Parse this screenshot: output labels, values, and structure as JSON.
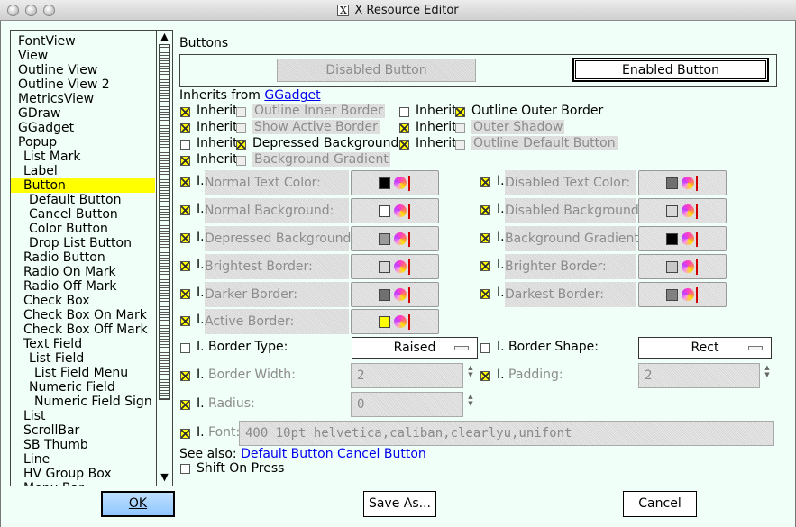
{
  "window": {
    "title": "X Resource Editor",
    "x_glyph": "X"
  },
  "list": {
    "items": [
      {
        "label": "FontView",
        "indent": 0
      },
      {
        "label": "View",
        "indent": 0
      },
      {
        "label": "Outline View",
        "indent": 0
      },
      {
        "label": "Outline View 2",
        "indent": 0
      },
      {
        "label": "MetricsView",
        "indent": 0
      },
      {
        "label": "GDraw",
        "indent": 0
      },
      {
        "label": "GGadget",
        "indent": 0
      },
      {
        "label": "Popup",
        "indent": 0
      },
      {
        "label": "List Mark",
        "indent": 1
      },
      {
        "label": "Label",
        "indent": 1
      },
      {
        "label": "Button",
        "indent": 1,
        "selected": true
      },
      {
        "label": "Default Button",
        "indent": 2
      },
      {
        "label": "Cancel Button",
        "indent": 2
      },
      {
        "label": "Color Button",
        "indent": 2
      },
      {
        "label": "Drop List Button",
        "indent": 2
      },
      {
        "label": "Radio Button",
        "indent": 1
      },
      {
        "label": "Radio On Mark",
        "indent": 1
      },
      {
        "label": "Radio Off Mark",
        "indent": 1
      },
      {
        "label": "Check Box",
        "indent": 1
      },
      {
        "label": "Check Box On Mark",
        "indent": 1
      },
      {
        "label": "Check Box Off Mark",
        "indent": 1
      },
      {
        "label": "Text Field",
        "indent": 1
      },
      {
        "label": "List Field",
        "indent": 2
      },
      {
        "label": "List Field Menu",
        "indent": 3
      },
      {
        "label": "Numeric Field",
        "indent": 2
      },
      {
        "label": "Numeric Field Sign",
        "indent": 3
      },
      {
        "label": "List",
        "indent": 1
      },
      {
        "label": "ScrollBar",
        "indent": 1
      },
      {
        "label": "SB Thumb",
        "indent": 1
      },
      {
        "label": "Line",
        "indent": 1
      },
      {
        "label": "HV Group Box",
        "indent": 1
      },
      {
        "label": "Menu Bar",
        "indent": 1
      }
    ],
    "scroll_up": "▲",
    "scroll_down": "▼"
  },
  "section": {
    "title": "Buttons"
  },
  "preview": {
    "disabled_label": "Disabled Button",
    "enabled_label": "Enabled Button"
  },
  "inherits": {
    "prefix": "Inherits from",
    "link": "GGadget"
  },
  "inherit_word": "Inherit",
  "flags": [
    {
      "inherit": true,
      "label": "Outline Inner Border",
      "checked": false,
      "dim": true
    },
    {
      "inherit": false,
      "label": "Outline Outer Border",
      "checked": true,
      "dim": false
    },
    {
      "inherit": true,
      "label": "Show Active Border",
      "checked": false,
      "dim": true
    },
    {
      "inherit": true,
      "label": "Outer Shadow",
      "checked": false,
      "dim": true
    },
    {
      "inherit": false,
      "label": "Depressed Background",
      "checked": true,
      "dim": false
    },
    {
      "inherit": true,
      "label": "Outline Default Button",
      "checked": false,
      "dim": true
    },
    {
      "inherit": true,
      "label": "Background Gradient",
      "checked": false,
      "dim": true
    }
  ],
  "colors_left": [
    {
      "label": "Normal Text Color:",
      "swatch": "#000000",
      "inherit": true
    },
    {
      "label": "Normal Background:",
      "swatch": "#ffffff",
      "inherit": true
    },
    {
      "label": "Depressed Background:",
      "swatch": "#9a9a9a",
      "inherit": true
    },
    {
      "label": "Brightest Border:",
      "swatch": "#d8d8d8",
      "inherit": true
    },
    {
      "label": "Darker Border:",
      "swatch": "#707070",
      "inherit": true
    },
    {
      "label": "Active Border:",
      "swatch": "#ffff00",
      "inherit": true
    }
  ],
  "colors_right": [
    {
      "label": "Disabled Text Color:",
      "swatch": "#707070",
      "inherit": true
    },
    {
      "label": "Disabled Background:",
      "swatch": "#d8d8d8",
      "inherit": true
    },
    {
      "label": "Background Gradient:",
      "swatch": "#000000",
      "inherit": true
    },
    {
      "label": "Brighter Border:",
      "swatch": "#c8c8c8",
      "inherit": true
    },
    {
      "label": "Darkest Border:",
      "swatch": "#808080",
      "inherit": true
    }
  ],
  "inherit_prefix": "I.",
  "border_type": {
    "label": "Border Type:",
    "value": "Raised",
    "inherit": false
  },
  "border_shape": {
    "label": "Border Shape:",
    "value": "Rect",
    "inherit": false
  },
  "border_width": {
    "label": "Border Width:",
    "value": "2",
    "inherit": true
  },
  "padding": {
    "label": "Padding:",
    "value": "2",
    "inherit": true
  },
  "radius": {
    "label": "Radius:",
    "value": "0",
    "inherit": true
  },
  "font": {
    "label": "Font:",
    "value": "400 10pt helvetica,caliban,clearlyu,unifont",
    "inherit": true
  },
  "see_also": {
    "prefix": "See also:",
    "links": [
      "Default Button",
      "Cancel Button"
    ]
  },
  "shift_on_press": {
    "label": "Shift On Press",
    "checked": false
  },
  "buttons": {
    "ok": "OK",
    "save_as": "Save As...",
    "cancel": "Cancel"
  },
  "colors": {
    "selection": "#ffff00",
    "ok_button": "#9fd0ff",
    "link": "#0000ee"
  }
}
